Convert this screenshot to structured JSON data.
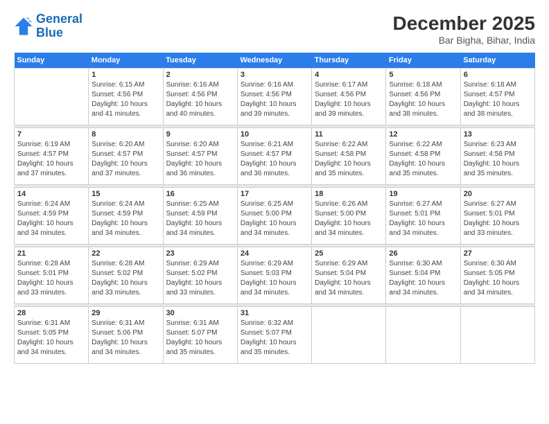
{
  "logo": {
    "line1": "General",
    "line2": "Blue"
  },
  "title": {
    "month_year": "December 2025",
    "location": "Bar Bigha, Bihar, India"
  },
  "days_of_week": [
    "Sunday",
    "Monday",
    "Tuesday",
    "Wednesday",
    "Thursday",
    "Friday",
    "Saturday"
  ],
  "weeks": [
    [
      {
        "day": "",
        "sunrise": "",
        "sunset": "",
        "daylight": "",
        "empty": true
      },
      {
        "day": "1",
        "sunrise": "Sunrise: 6:15 AM",
        "sunset": "Sunset: 4:56 PM",
        "daylight": "Daylight: 10 hours and 41 minutes."
      },
      {
        "day": "2",
        "sunrise": "Sunrise: 6:16 AM",
        "sunset": "Sunset: 4:56 PM",
        "daylight": "Daylight: 10 hours and 40 minutes."
      },
      {
        "day": "3",
        "sunrise": "Sunrise: 6:16 AM",
        "sunset": "Sunset: 4:56 PM",
        "daylight": "Daylight: 10 hours and 39 minutes."
      },
      {
        "day": "4",
        "sunrise": "Sunrise: 6:17 AM",
        "sunset": "Sunset: 4:56 PM",
        "daylight": "Daylight: 10 hours and 39 minutes."
      },
      {
        "day": "5",
        "sunrise": "Sunrise: 6:18 AM",
        "sunset": "Sunset: 4:56 PM",
        "daylight": "Daylight: 10 hours and 38 minutes."
      },
      {
        "day": "6",
        "sunrise": "Sunrise: 6:18 AM",
        "sunset": "Sunset: 4:57 PM",
        "daylight": "Daylight: 10 hours and 38 minutes."
      }
    ],
    [
      {
        "day": "7",
        "sunrise": "Sunrise: 6:19 AM",
        "sunset": "Sunset: 4:57 PM",
        "daylight": "Daylight: 10 hours and 37 minutes."
      },
      {
        "day": "8",
        "sunrise": "Sunrise: 6:20 AM",
        "sunset": "Sunset: 4:57 PM",
        "daylight": "Daylight: 10 hours and 37 minutes."
      },
      {
        "day": "9",
        "sunrise": "Sunrise: 6:20 AM",
        "sunset": "Sunset: 4:57 PM",
        "daylight": "Daylight: 10 hours and 36 minutes."
      },
      {
        "day": "10",
        "sunrise": "Sunrise: 6:21 AM",
        "sunset": "Sunset: 4:57 PM",
        "daylight": "Daylight: 10 hours and 36 minutes."
      },
      {
        "day": "11",
        "sunrise": "Sunrise: 6:22 AM",
        "sunset": "Sunset: 4:58 PM",
        "daylight": "Daylight: 10 hours and 35 minutes."
      },
      {
        "day": "12",
        "sunrise": "Sunrise: 6:22 AM",
        "sunset": "Sunset: 4:58 PM",
        "daylight": "Daylight: 10 hours and 35 minutes."
      },
      {
        "day": "13",
        "sunrise": "Sunrise: 6:23 AM",
        "sunset": "Sunset: 4:58 PM",
        "daylight": "Daylight: 10 hours and 35 minutes."
      }
    ],
    [
      {
        "day": "14",
        "sunrise": "Sunrise: 6:24 AM",
        "sunset": "Sunset: 4:59 PM",
        "daylight": "Daylight: 10 hours and 34 minutes."
      },
      {
        "day": "15",
        "sunrise": "Sunrise: 6:24 AM",
        "sunset": "Sunset: 4:59 PM",
        "daylight": "Daylight: 10 hours and 34 minutes."
      },
      {
        "day": "16",
        "sunrise": "Sunrise: 6:25 AM",
        "sunset": "Sunset: 4:59 PM",
        "daylight": "Daylight: 10 hours and 34 minutes."
      },
      {
        "day": "17",
        "sunrise": "Sunrise: 6:25 AM",
        "sunset": "Sunset: 5:00 PM",
        "daylight": "Daylight: 10 hours and 34 minutes."
      },
      {
        "day": "18",
        "sunrise": "Sunrise: 6:26 AM",
        "sunset": "Sunset: 5:00 PM",
        "daylight": "Daylight: 10 hours and 34 minutes."
      },
      {
        "day": "19",
        "sunrise": "Sunrise: 6:27 AM",
        "sunset": "Sunset: 5:01 PM",
        "daylight": "Daylight: 10 hours and 34 minutes."
      },
      {
        "day": "20",
        "sunrise": "Sunrise: 6:27 AM",
        "sunset": "Sunset: 5:01 PM",
        "daylight": "Daylight: 10 hours and 33 minutes."
      }
    ],
    [
      {
        "day": "21",
        "sunrise": "Sunrise: 6:28 AM",
        "sunset": "Sunset: 5:01 PM",
        "daylight": "Daylight: 10 hours and 33 minutes."
      },
      {
        "day": "22",
        "sunrise": "Sunrise: 6:28 AM",
        "sunset": "Sunset: 5:02 PM",
        "daylight": "Daylight: 10 hours and 33 minutes."
      },
      {
        "day": "23",
        "sunrise": "Sunrise: 6:29 AM",
        "sunset": "Sunset: 5:02 PM",
        "daylight": "Daylight: 10 hours and 33 minutes."
      },
      {
        "day": "24",
        "sunrise": "Sunrise: 6:29 AM",
        "sunset": "Sunset: 5:03 PM",
        "daylight": "Daylight: 10 hours and 34 minutes."
      },
      {
        "day": "25",
        "sunrise": "Sunrise: 6:29 AM",
        "sunset": "Sunset: 5:04 PM",
        "daylight": "Daylight: 10 hours and 34 minutes."
      },
      {
        "day": "26",
        "sunrise": "Sunrise: 6:30 AM",
        "sunset": "Sunset: 5:04 PM",
        "daylight": "Daylight: 10 hours and 34 minutes."
      },
      {
        "day": "27",
        "sunrise": "Sunrise: 6:30 AM",
        "sunset": "Sunset: 5:05 PM",
        "daylight": "Daylight: 10 hours and 34 minutes."
      }
    ],
    [
      {
        "day": "28",
        "sunrise": "Sunrise: 6:31 AM",
        "sunset": "Sunset: 5:05 PM",
        "daylight": "Daylight: 10 hours and 34 minutes."
      },
      {
        "day": "29",
        "sunrise": "Sunrise: 6:31 AM",
        "sunset": "Sunset: 5:06 PM",
        "daylight": "Daylight: 10 hours and 34 minutes."
      },
      {
        "day": "30",
        "sunrise": "Sunrise: 6:31 AM",
        "sunset": "Sunset: 5:07 PM",
        "daylight": "Daylight: 10 hours and 35 minutes."
      },
      {
        "day": "31",
        "sunrise": "Sunrise: 6:32 AM",
        "sunset": "Sunset: 5:07 PM",
        "daylight": "Daylight: 10 hours and 35 minutes."
      },
      {
        "day": "",
        "sunrise": "",
        "sunset": "",
        "daylight": "",
        "empty": true
      },
      {
        "day": "",
        "sunrise": "",
        "sunset": "",
        "daylight": "",
        "empty": true
      },
      {
        "day": "",
        "sunrise": "",
        "sunset": "",
        "daylight": "",
        "empty": true
      }
    ]
  ]
}
